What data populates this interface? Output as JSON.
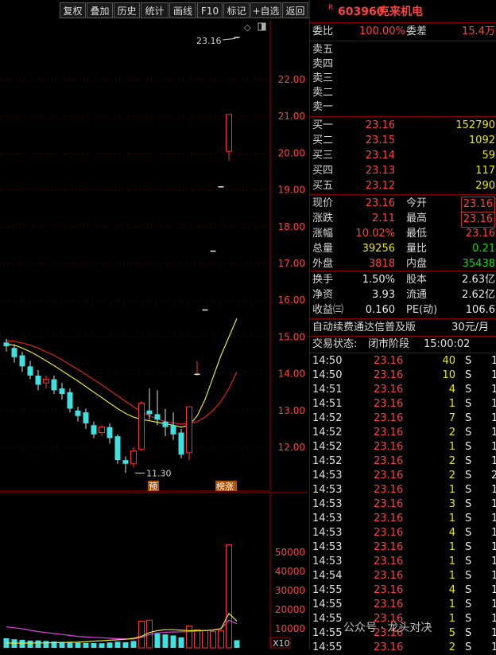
{
  "toolbar": {
    "buttons": [
      "复权",
      "叠加",
      "历史",
      "统计",
      "画线",
      "F10",
      "标记",
      "+自选",
      "返回"
    ]
  },
  "stock": {
    "badge": "R",
    "code": "603960",
    "name": "克来机电"
  },
  "commission": {
    "ratio_label": "委比",
    "ratio_value": "100.00%",
    "diff_label": "委差",
    "diff_value": "15.4万"
  },
  "asks": [
    {
      "label": "卖五",
      "price": "",
      "vol": ""
    },
    {
      "label": "卖四",
      "price": "",
      "vol": ""
    },
    {
      "label": "卖三",
      "price": "",
      "vol": ""
    },
    {
      "label": "卖二",
      "price": "",
      "vol": ""
    },
    {
      "label": "卖一",
      "price": "",
      "vol": ""
    }
  ],
  "bids": [
    {
      "label": "买一",
      "price": "23.16",
      "vol": "152790"
    },
    {
      "label": "买二",
      "price": "23.15",
      "vol": "1092"
    },
    {
      "label": "买三",
      "price": "23.14",
      "vol": "59"
    },
    {
      "label": "买四",
      "price": "23.13",
      "vol": "117"
    },
    {
      "label": "买五",
      "price": "23.12",
      "vol": "290"
    }
  ],
  "quote": [
    {
      "l1": "现价",
      "v1": "23.16",
      "l2": "今开",
      "v2": "23.16"
    },
    {
      "l1": "涨跌",
      "v1": "2.11",
      "l2": "最高",
      "v2": "23.16"
    },
    {
      "l1": "涨幅",
      "v1": "10.02%",
      "l2": "最低",
      "v2": "23.16"
    },
    {
      "l1": "总量",
      "v1": "39256",
      "l2": "量比",
      "v2": "0.21"
    },
    {
      "l1": "外盘",
      "v1": "3818",
      "l2": "内盘",
      "v2": "35438"
    }
  ],
  "finance": [
    {
      "l1": "换手",
      "v1": "1.50%",
      "l2": "股本",
      "v2": "2.63亿"
    },
    {
      "l1": "净资",
      "v1": "3.93",
      "l2": "流通",
      "v2": "2.62亿"
    },
    {
      "l1": "收益㈢",
      "v1": "0.160",
      "l2": "PE(动)",
      "v2": "106.6"
    }
  ],
  "promo": {
    "text": "自动续费通达信普及版",
    "price": "30元/月"
  },
  "status": {
    "label": "交易状态:",
    "value": "闭市阶段",
    "time": "15:00:02"
  },
  "trades": [
    {
      "time": "14:50",
      "price": "23.16",
      "vol": "40",
      "dir": "S",
      "cnt": "1"
    },
    {
      "time": "14:50",
      "price": "23.16",
      "vol": "10",
      "dir": "S",
      "cnt": "1"
    },
    {
      "time": "14:51",
      "price": "23.16",
      "vol": "4",
      "dir": "S",
      "cnt": "1"
    },
    {
      "time": "14:51",
      "price": "23.16",
      "vol": "1",
      "dir": "S",
      "cnt": "1"
    },
    {
      "time": "14:52",
      "price": "23.16",
      "vol": "7",
      "dir": "S",
      "cnt": "1"
    },
    {
      "time": "14:52",
      "price": "23.16",
      "vol": "2",
      "dir": "S",
      "cnt": "1"
    },
    {
      "time": "14:52",
      "price": "23.16",
      "vol": "1",
      "dir": "S",
      "cnt": "1"
    },
    {
      "time": "14:52",
      "price": "23.16",
      "vol": "2",
      "dir": "S",
      "cnt": "1"
    },
    {
      "time": "14:53",
      "price": "23.16",
      "vol": "2",
      "dir": "S",
      "cnt": "2"
    },
    {
      "time": "14:53",
      "price": "23.16",
      "vol": "1",
      "dir": "S",
      "cnt": "1"
    },
    {
      "time": "14:53",
      "price": "23.16",
      "vol": "3",
      "dir": "S",
      "cnt": "1"
    },
    {
      "time": "14:53",
      "price": "23.16",
      "vol": "1",
      "dir": "S",
      "cnt": "1"
    },
    {
      "time": "14:53",
      "price": "23.16",
      "vol": "4",
      "dir": "S",
      "cnt": "1"
    },
    {
      "time": "14:53",
      "price": "23.16",
      "vol": "1",
      "dir": "S",
      "cnt": "1"
    },
    {
      "time": "14:53",
      "price": "23.16",
      "vol": "1",
      "dir": "S",
      "cnt": "1"
    },
    {
      "time": "14:54",
      "price": "23.16",
      "vol": "1",
      "dir": "S",
      "cnt": "1"
    },
    {
      "time": "14:55",
      "price": "23.16",
      "vol": "4",
      "dir": "S",
      "cnt": "1"
    },
    {
      "time": "14:55",
      "price": "23.16",
      "vol": "1",
      "dir": "S",
      "cnt": "1"
    },
    {
      "time": "14:55",
      "price": "23.16",
      "vol": "1",
      "dir": "S",
      "cnt": "1"
    },
    {
      "time": "14:55",
      "price": "23.16",
      "vol": "5",
      "dir": "S",
      "cnt": "1"
    },
    {
      "time": "14:55",
      "price": "23.16",
      "vol": "2",
      "dir": "S",
      "cnt": "1"
    }
  ],
  "watermark": "公众号 · 龙头对决",
  "chart_data": [
    {
      "type": "candlestick",
      "y_ticks": [
        "22.00",
        "21.00",
        "20.00",
        "19.00",
        "18.00",
        "17.00",
        "16.00",
        "15.00",
        "14.00",
        "13.00",
        "12.00"
      ],
      "ylim": [
        11.2,
        23.5
      ],
      "annotations": [
        "23.16",
        "11.30"
      ],
      "markers": [
        "预",
        "榜涨"
      ],
      "candles": [
        {
          "o": 14.85,
          "c": 14.75,
          "h": 14.95,
          "l": 14.6
        },
        {
          "o": 14.7,
          "c": 14.45,
          "h": 14.8,
          "l": 14.3
        },
        {
          "o": 14.5,
          "c": 14.2,
          "h": 14.6,
          "l": 14.05
        },
        {
          "o": 14.2,
          "c": 13.95,
          "h": 14.35,
          "l": 13.85
        },
        {
          "o": 13.95,
          "c": 13.7,
          "h": 14.1,
          "l": 13.55
        },
        {
          "o": 13.75,
          "c": 13.85,
          "h": 13.95,
          "l": 13.6
        },
        {
          "o": 13.85,
          "c": 13.55,
          "h": 13.95,
          "l": 13.45
        },
        {
          "o": 13.6,
          "c": 13.45,
          "h": 13.75,
          "l": 13.3
        },
        {
          "o": 13.5,
          "c": 13.05,
          "h": 13.6,
          "l": 12.95
        },
        {
          "o": 13.0,
          "c": 12.85,
          "h": 13.1,
          "l": 12.7
        },
        {
          "o": 12.95,
          "c": 12.65,
          "h": 13.05,
          "l": 12.5
        },
        {
          "o": 12.6,
          "c": 12.35,
          "h": 12.7,
          "l": 12.25
        },
        {
          "o": 12.4,
          "c": 12.55,
          "h": 12.6,
          "l": 12.3
        },
        {
          "o": 12.55,
          "c": 12.25,
          "h": 12.65,
          "l": 12.1
        },
        {
          "o": 12.3,
          "c": 11.65,
          "h": 12.35,
          "l": 11.55
        },
        {
          "o": 11.65,
          "c": 11.55,
          "h": 11.75,
          "l": 11.3
        },
        {
          "o": 11.55,
          "c": 11.9,
          "h": 12.0,
          "l": 11.45
        },
        {
          "o": 11.95,
          "c": 13.2,
          "h": 13.25,
          "l": 11.9
        },
        {
          "o": 13.0,
          "c": 12.9,
          "h": 13.6,
          "l": 12.75
        },
        {
          "o": 12.9,
          "c": 12.75,
          "h": 13.55,
          "l": 12.6
        },
        {
          "o": 12.7,
          "c": 12.55,
          "h": 13.05,
          "l": 12.3
        },
        {
          "o": 12.6,
          "c": 12.35,
          "h": 12.95,
          "l": 12.2
        },
        {
          "o": 12.4,
          "c": 11.8,
          "h": 12.5,
          "l": 11.7
        },
        {
          "o": 11.85,
          "c": 13.1,
          "h": 13.1,
          "l": 11.65
        },
        {
          "o": 14.0,
          "c": 14.0,
          "h": 14.35,
          "l": 13.95
        },
        {
          "o": 15.75,
          "c": 15.75,
          "h": 15.75,
          "l": 15.75
        },
        {
          "o": 17.35,
          "c": 17.35,
          "h": 17.35,
          "l": 17.35
        },
        {
          "o": 19.1,
          "c": 19.1,
          "h": 19.1,
          "l": 19.1
        },
        {
          "o": 20.05,
          "c": 21.05,
          "h": 21.05,
          "l": 19.8
        },
        {
          "o": 23.16,
          "c": 23.16,
          "h": 23.16,
          "l": 23.16
        }
      ],
      "ma_yellow": [
        14.8,
        14.78,
        14.7,
        14.6,
        14.48,
        14.35,
        14.22,
        14.08,
        13.94,
        13.8,
        13.65,
        13.5,
        13.35,
        13.2,
        13.05,
        12.92,
        12.82,
        12.76,
        12.72,
        12.68,
        12.64,
        12.6,
        12.55,
        12.6,
        12.85,
        13.3,
        13.9,
        14.5,
        15.0,
        15.5
      ],
      "ma_red": [
        14.9,
        14.88,
        14.84,
        14.78,
        14.7,
        14.6,
        14.5,
        14.38,
        14.25,
        14.12,
        13.98,
        13.84,
        13.7,
        13.55,
        13.4,
        13.25,
        13.1,
        12.97,
        12.86,
        12.77,
        12.7,
        12.66,
        12.63,
        12.64,
        12.7,
        12.82,
        13.0,
        13.25,
        13.6,
        14.05
      ]
    },
    {
      "type": "bar",
      "y_ticks": [
        "50000",
        "40000",
        "30000",
        "20000",
        "10000"
      ],
      "ylim": [
        0,
        58000
      ],
      "multiplier": "X10",
      "values": [
        5000,
        4500,
        4200,
        3800,
        3900,
        3600,
        3300,
        3100,
        2900,
        2700,
        2600,
        2500,
        2400,
        2800,
        3200,
        2900,
        3600,
        14000,
        14500,
        7500,
        7000,
        6500,
        5500,
        11500,
        9500,
        9000,
        8500,
        9000,
        54000,
        4000
      ],
      "colors": [
        "c",
        "c",
        "c",
        "c",
        "c",
        "c",
        "c",
        "c",
        "c",
        "c",
        "c",
        "c",
        "c",
        "c",
        "c",
        "c",
        "c",
        "r",
        "r",
        "c",
        "c",
        "c",
        "c",
        "r",
        "r",
        "r",
        "r",
        "r",
        "r",
        "c"
      ],
      "ma_yellow": [
        2500,
        2500,
        2500,
        2500,
        2600,
        2600,
        2700,
        2800,
        2900,
        3000,
        3200,
        3500,
        3700,
        4000,
        4200,
        4500,
        5000,
        6000,
        8000,
        9000,
        9500,
        9500,
        9200,
        9000,
        9000,
        9100,
        9200,
        10000,
        18000,
        14000
      ],
      "ma_magenta": [
        11000,
        10500,
        10000,
        9200,
        8500,
        8000,
        7500,
        7000,
        6500,
        6000,
        5800,
        5500,
        5300,
        5000,
        4800,
        4700,
        4600,
        5500,
        7000,
        7800,
        8200,
        8300,
        8400,
        8500,
        8800,
        9000,
        9400,
        10000,
        14500,
        12500
      ]
    }
  ]
}
